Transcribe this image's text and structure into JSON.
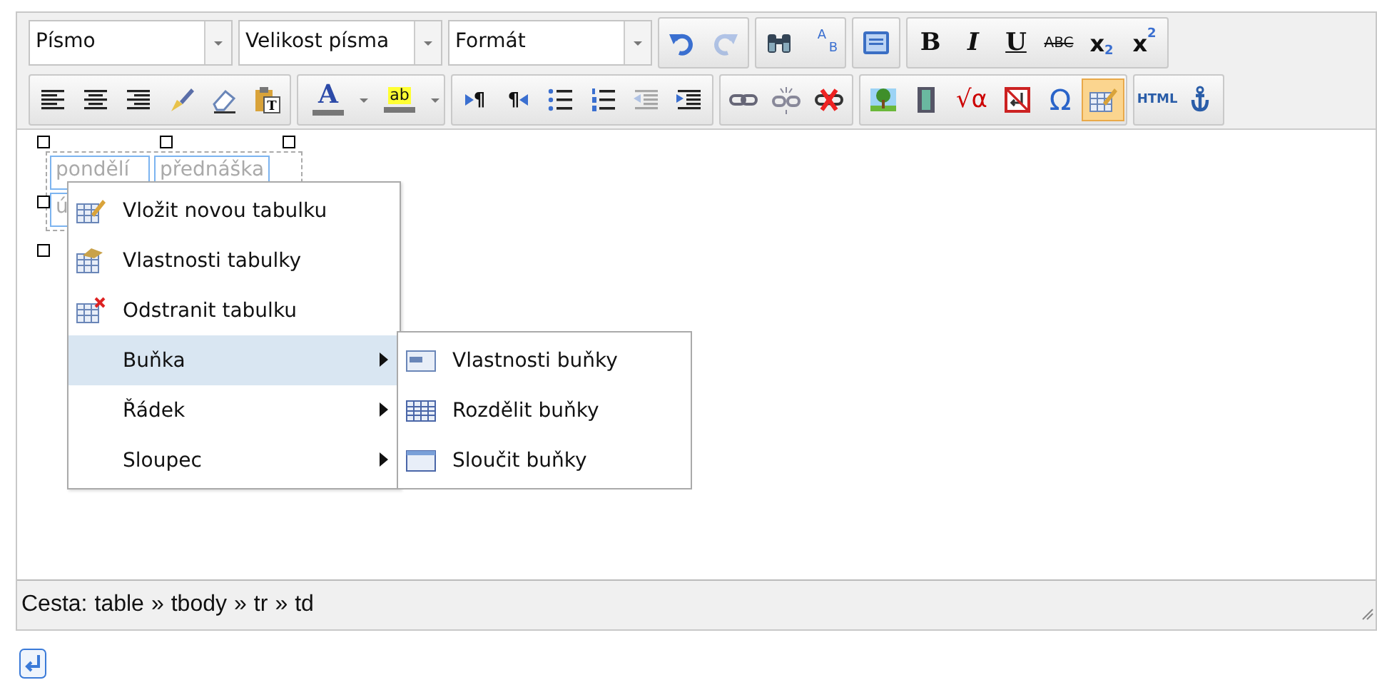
{
  "toolbar": {
    "rows": [
      {
        "selects": [
          {
            "value": "Písmo"
          },
          {
            "value": "Velikost písma"
          },
          {
            "value": "Formát"
          }
        ],
        "groups": [
          [
            {
              "kind": "undo",
              "disabled": false,
              "selected": false
            },
            {
              "kind": "redo",
              "disabled": true,
              "selected": false
            }
          ],
          [
            {
              "kind": "find",
              "disabled": false,
              "selected": false
            },
            {
              "kind": "replace",
              "label": "A",
              "label2": "B",
              "disabled": false,
              "selected": false
            }
          ],
          [
            {
              "kind": "fullscreen",
              "disabled": false,
              "selected": false
            }
          ],
          [
            {
              "kind": "bold",
              "label": "B",
              "disabled": false,
              "selected": false
            },
            {
              "kind": "italic",
              "label": "I",
              "disabled": false,
              "selected": false
            },
            {
              "kind": "underline",
              "label": "U",
              "disabled": false,
              "selected": false
            },
            {
              "kind": "strike",
              "label": "ABC",
              "disabled": false,
              "selected": false
            },
            {
              "kind": "sub",
              "label": "x$_{2}$",
              "disabled": false,
              "selected": false
            },
            {
              "kind": "sup",
              "label": "x$^{2}$",
              "disabled": false,
              "selected": false
            }
          ]
        ]
      },
      {
        "groups": [
          [
            {
              "kind": "align-left",
              "disabled": false,
              "selected": false
            },
            {
              "kind": "align-center",
              "disabled": false,
              "selected": false
            },
            {
              "kind": "align-right",
              "disabled": false,
              "selected": false
            },
            {
              "kind": "brush",
              "disabled": false,
              "selected": false
            },
            {
              "kind": "eraser",
              "disabled": false,
              "selected": false
            },
            {
              "kind": "paste-text",
              "label": "T",
              "disabled": false,
              "selected": false
            }
          ],
          [
            {
              "kind": "font-color",
              "label": "A",
              "disabled": false,
              "selected": false
            },
            {
              "kind": "highlight",
              "label": "ab",
              "disabled": false,
              "selected": false
            }
          ],
          [
            {
              "kind": "ltr",
              "label": "¶",
              "disabled": false,
              "selected": false
            },
            {
              "kind": "rtl",
              "label": "¶",
              "disabled": false,
              "selected": false
            },
            {
              "kind": "bullets",
              "disabled": false,
              "selected": false
            },
            {
              "kind": "numbers",
              "disabled": false,
              "selected": false
            },
            {
              "kind": "outdent",
              "disabled": true,
              "selected": false
            },
            {
              "kind": "indent",
              "disabled": false,
              "selected": false
            }
          ],
          [
            {
              "kind": "link",
              "disabled": false,
              "selected": false
            },
            {
              "kind": "unlink",
              "disabled": false,
              "selected": false
            },
            {
              "kind": "nolink",
              "disabled": false,
              "selected": false
            }
          ],
          [
            {
              "kind": "image",
              "disabled": false,
              "selected": false
            },
            {
              "kind": "media",
              "disabled": false,
              "selected": false
            },
            {
              "kind": "equation",
              "label": "√α",
              "disabled": false,
              "selected": false
            },
            {
              "kind": "nonbreak",
              "disabled": false,
              "selected": false
            },
            {
              "kind": "charmap",
              "label": "Ω",
              "disabled": false,
              "selected": false
            },
            {
              "kind": "table",
              "disabled": false,
              "selected": true
            }
          ],
          [
            {
              "kind": "html",
              "label": "HTML",
              "disabled": false,
              "selected": false
            },
            {
              "kind": "anchor",
              "disabled": false,
              "selected": false
            }
          ]
        ]
      }
    ]
  },
  "content": {
    "table": {
      "rows": [
        [
          "pondělí",
          "přednáška"
        ],
        [
          "ú"
        ]
      ]
    }
  },
  "context_menu": {
    "items": [
      {
        "kind": "insert-table",
        "label": "Vložit novou tabulku",
        "submenu": false,
        "selected": false
      },
      {
        "kind": "table-props",
        "label": "Vlastnosti tabulky",
        "submenu": false,
        "selected": false
      },
      {
        "kind": "delete-table",
        "label": "Odstranit tabulku",
        "submenu": false,
        "selected": false
      },
      {
        "kind": "none",
        "label": "Buňka",
        "submenu": true,
        "selected": true
      },
      {
        "kind": "none",
        "label": "Řádek",
        "submenu": true,
        "selected": false
      },
      {
        "kind": "none",
        "label": "Sloupec",
        "submenu": true,
        "selected": false
      }
    ],
    "submenu": {
      "items": [
        {
          "kind": "cell-props",
          "label": "Vlastnosti buňky",
          "selected": false
        },
        {
          "kind": "split-cells",
          "label": "Rozdělit buňky",
          "selected": false
        },
        {
          "kind": "merge-cells",
          "label": "Sloučit buňky",
          "selected": false
        }
      ]
    }
  },
  "status_bar": {
    "path_label": "Cesta:",
    "path": [
      "table",
      "tbody",
      "tr",
      "td"
    ],
    "separator": "»"
  }
}
